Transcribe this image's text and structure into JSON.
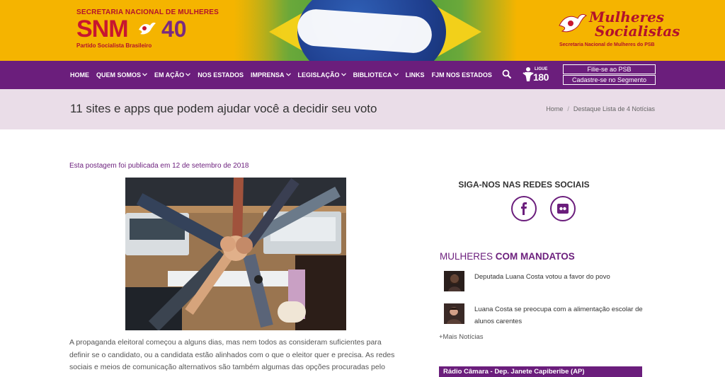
{
  "header": {
    "snm": {
      "top": "SECRETARIA NACIONAL DE MULHERES",
      "main": "SNM",
      "number": "40",
      "sub": "Partido Socialista Brasileiro"
    },
    "ms": {
      "title_line1": "Mulheres",
      "title_line2": "Socialistas",
      "sub": "Secretaria Nacional de Mulheres do PSB"
    },
    "colors": {
      "banner": "#f5b400",
      "purple": "#6b1e7c",
      "red": "#b3122b"
    }
  },
  "nav": {
    "items": [
      {
        "label": "HOME",
        "dropdown": false
      },
      {
        "label": "QUEM SOMOS",
        "dropdown": true
      },
      {
        "label": "EM AÇÃO",
        "dropdown": true
      },
      {
        "label": "NOS ESTADOS",
        "dropdown": false
      },
      {
        "label": "IMPRENSA",
        "dropdown": true
      },
      {
        "label": "LEGISLAÇÃO",
        "dropdown": true
      },
      {
        "label": "BIBLIOTECA",
        "dropdown": true
      },
      {
        "label": "LINKS",
        "dropdown": false
      },
      {
        "label": "FJM NOS ESTADOS",
        "dropdown": false
      }
    ],
    "search_icon": "search-icon",
    "ligue": {
      "top": "LIGUE",
      "number": "180"
    },
    "filie_label": "Filie-se ao PSB",
    "cadastre_label": "Cadastre-se no Segmento"
  },
  "titlebar": {
    "title": "11 sites e apps que podem ajudar você a decidir seu voto",
    "breadcrumb": [
      "Home",
      "Destaque Lista de 4 Notícias"
    ]
  },
  "post": {
    "published": "Esta postagem foi publicada em 12 de setembro de 2018",
    "body": "A propaganda eleitoral começou a alguns dias, mas nem todos as consideram suficientes para definir se o candidato, ou a candidata estão alinhados com o que o eleitor quer e precisa. As redes sociais e meios de comunicação alternativos são também algumas das opções procuradas pelo"
  },
  "sidebar": {
    "follow_title": "SIGA-NOS NAS REDES SOCIAIS",
    "social": [
      "facebook-icon",
      "flickr-icon"
    ],
    "mandatos_prefix": "MULHERES",
    "mandatos_bold": "COM MANDATOS",
    "news": [
      {
        "text": "Deputada Luana Costa votou a favor do povo"
      },
      {
        "text": "Luana Costa se preocupa com a alimentação escolar de alunos carentes"
      }
    ],
    "mais": "+Mais Notícias",
    "radio": "Rádio Câmara - Dep. Janete Capiberibe (AP)"
  }
}
